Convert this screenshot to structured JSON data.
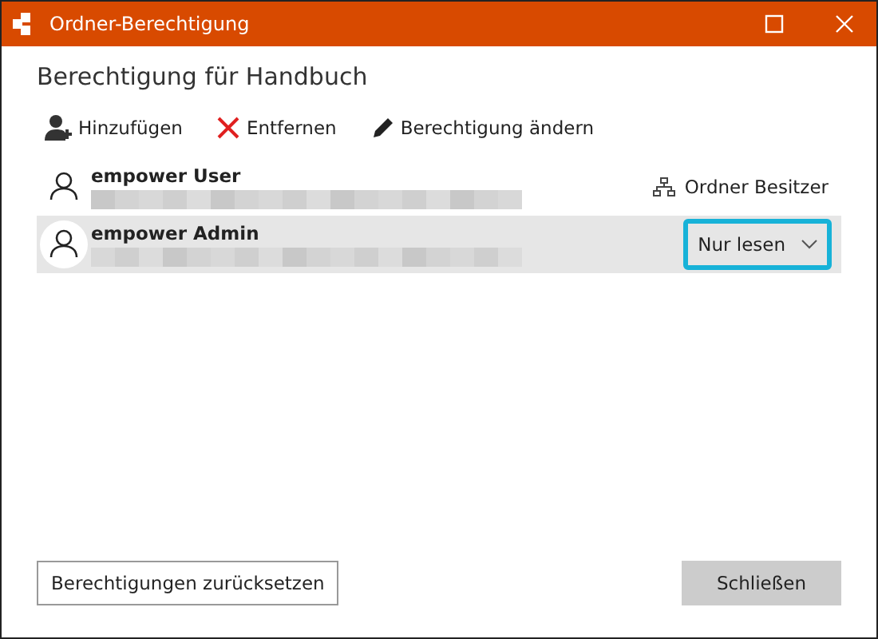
{
  "window": {
    "title": "Ordner-Berechtigung"
  },
  "heading": "Berechtigung für Handbuch",
  "toolbar": [
    {
      "kind": "add",
      "label": "Hinzufügen"
    },
    {
      "kind": "remove",
      "label": "Entfernen"
    },
    {
      "kind": "edit",
      "label": "Berechtigung ändern"
    }
  ],
  "users": [
    {
      "name": "empower User",
      "selected": false,
      "kind": "owner",
      "role": "Ordner Besitzer"
    },
    {
      "name": "empower Admin",
      "selected": true,
      "kind": "dropdown",
      "role": "Nur lesen"
    }
  ],
  "buttons": [
    {
      "label": "Berechtigungen zurücksetzen",
      "kind": "outline"
    },
    {
      "label": "Schließen",
      "kind": "filled"
    }
  ]
}
